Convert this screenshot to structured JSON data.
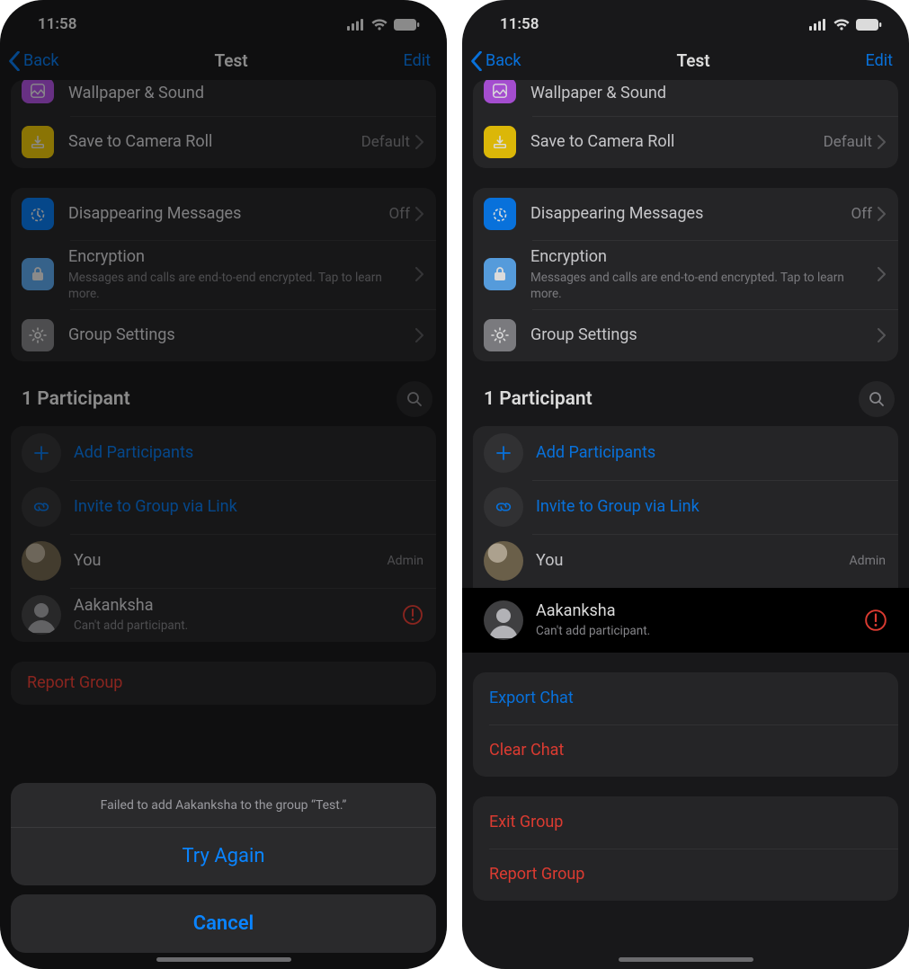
{
  "statusbar": {
    "time": "11:58"
  },
  "nav": {
    "back": "Back",
    "title": "Test",
    "edit": "Edit"
  },
  "rows": {
    "wallpaper": {
      "label": "Wallpaper & Sound"
    },
    "save_roll": {
      "label": "Save to Camera Roll",
      "value": "Default"
    },
    "disappearing": {
      "label": "Disappearing Messages",
      "value": "Off"
    },
    "encryption": {
      "label": "Encryption",
      "sub": "Messages and calls are end-to-end encrypted. Tap to learn more."
    },
    "group_settings": {
      "label": "Group Settings"
    }
  },
  "participants": {
    "header": "1 Participant",
    "add": "Add Participants",
    "invite": "Invite to Group via Link",
    "you": {
      "name": "You",
      "tag": "Admin"
    },
    "fail": {
      "name": "Aakanksha",
      "sub": "Can't add participant."
    }
  },
  "actions": {
    "export": "Export Chat",
    "clear": "Clear Chat",
    "exit": "Exit Group",
    "report": "Report Group"
  },
  "sheet": {
    "message": "Failed to add Aakanksha to the group “Test.”",
    "try_again": "Try Again",
    "cancel": "Cancel"
  },
  "colors": {
    "accent": "#0a84ff",
    "danger": "#ff453a",
    "wallpaper_icon": "#bf5af2",
    "save_icon": "#ffd60a",
    "disappear_icon": "#0a84ff",
    "encryption_icon": "#64b5ff",
    "settings_icon": "#8e8e93"
  }
}
